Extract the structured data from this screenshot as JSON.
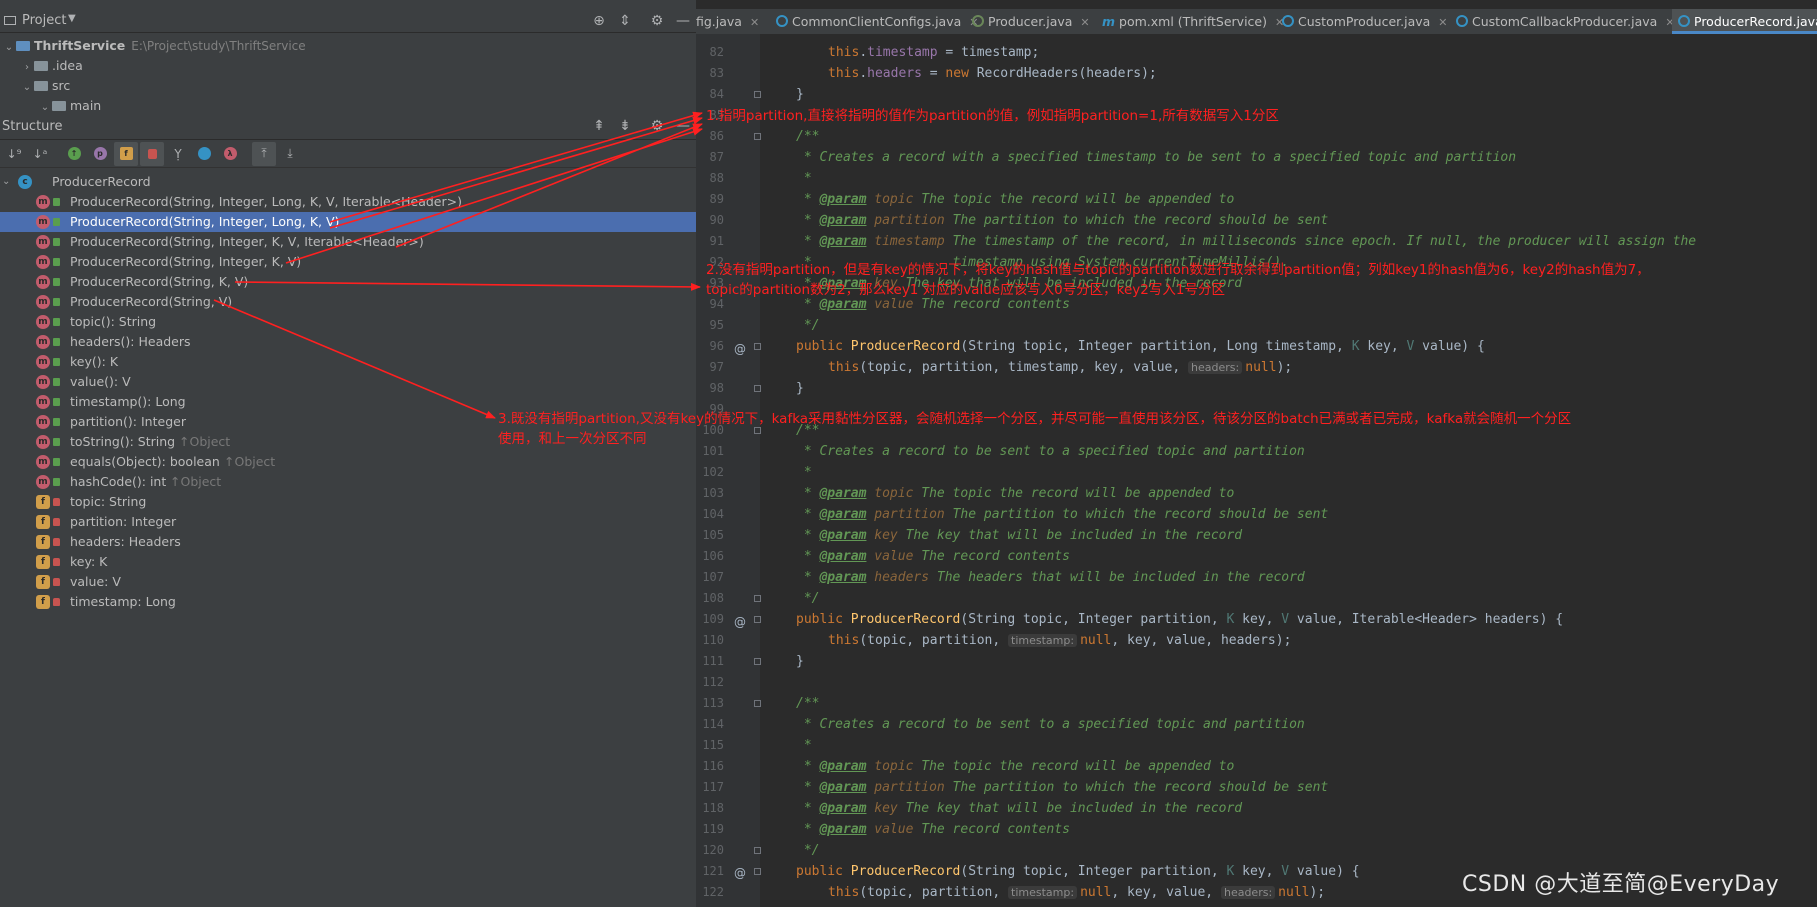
{
  "project_panel": {
    "title": "Project",
    "tree": [
      {
        "label": "ThriftService",
        "path": "E:\\Project\\study\\ThriftService"
      },
      {
        "label": ".idea"
      },
      {
        "label": "src"
      },
      {
        "label": "main"
      }
    ]
  },
  "structure_panel": {
    "title": "Structure",
    "root": "ProducerRecord",
    "items": [
      {
        "kind": "method",
        "label": "ProducerRecord(String, Integer, Long, K, V, Iterable<Header>)"
      },
      {
        "kind": "method",
        "label": "ProducerRecord(String, Integer, Long, K, V)",
        "selected": true
      },
      {
        "kind": "method",
        "label": "ProducerRecord(String, Integer, K, V, Iterable<Header>)"
      },
      {
        "kind": "method",
        "label": "ProducerRecord(String, Integer, K, V)"
      },
      {
        "kind": "method",
        "label": "ProducerRecord(String, K, V)"
      },
      {
        "kind": "method",
        "label": "ProducerRecord(String, V)"
      },
      {
        "kind": "method",
        "label": "topic(): String"
      },
      {
        "kind": "method",
        "label": "headers(): Headers"
      },
      {
        "kind": "method",
        "label": "key(): K"
      },
      {
        "kind": "method",
        "label": "value(): V"
      },
      {
        "kind": "method",
        "label": "timestamp(): Long"
      },
      {
        "kind": "method",
        "label": "partition(): Integer"
      },
      {
        "kind": "method",
        "label": "toString(): String",
        "inherited": "↑Object"
      },
      {
        "kind": "method",
        "label": "equals(Object): boolean",
        "inherited": "↑Object"
      },
      {
        "kind": "method",
        "label": "hashCode(): int",
        "inherited": "↑Object"
      },
      {
        "kind": "field",
        "label": "topic: String"
      },
      {
        "kind": "field",
        "label": "partition: Integer"
      },
      {
        "kind": "field",
        "label": "headers: Headers"
      },
      {
        "kind": "field",
        "label": "key: K"
      },
      {
        "kind": "field",
        "label": "value: V"
      },
      {
        "kind": "field",
        "label": "timestamp: Long"
      }
    ]
  },
  "tabs": [
    {
      "label": "fig.java"
    },
    {
      "label": "CommonClientConfigs.java"
    },
    {
      "label": "Producer.java"
    },
    {
      "label": "pom.xml (ThriftService)"
    },
    {
      "label": "CustomProducer.java"
    },
    {
      "label": "CustomCallbackProducer.java"
    },
    {
      "label": "ProducerRecord.java",
      "active": true
    }
  ],
  "code": {
    "line_numbers": [
      "82",
      "83",
      "84",
      "85",
      "86",
      "87",
      "88",
      "89",
      "90",
      "91",
      "92",
      "93",
      "94",
      "95",
      "96",
      "97",
      "98",
      "99",
      "100",
      "101",
      "102",
      "103",
      "104",
      "105",
      "106",
      "107",
      "108",
      "109",
      "110",
      "111",
      "112",
      "113",
      "114",
      "115",
      "116",
      "117",
      "118",
      "119",
      "120",
      "121",
      "122"
    ],
    "l82_this": "this",
    "l82_field": "timestamp",
    "l82_rest": " = timestamp;",
    "l83_this": "this",
    "l83_field": "headers",
    "l83_eq": " = ",
    "l83_new": "new",
    "l83_rest": " RecordHeaders(headers);",
    "l84": "}",
    "l86": "/**",
    "l87": " * Creates a record with a specified timestamp to be sent to a specified topic and partition",
    "l88": " *",
    "l89_tag": "@param",
    "l89_par": "topic",
    "l89_rest": " The topic the record will be appended to",
    "l90_tag": "@param",
    "l90_par": "partition",
    "l90_rest": " The partition to which the record should be sent",
    "l91_tag": "@param",
    "l91_par": "timestamp",
    "l91_rest": " The timestamp of the record, in milliseconds since epoch. If null, the producer will assign the",
    "l92": " *                  timestamp using System.currentTimeMillis().",
    "l93_tag": "@param",
    "l93_par": "key",
    "l93_rest": " The key that will be included in the record",
    "l94_tag": "@param",
    "l94_par": "value",
    "l94_rest": " The record contents",
    "l95": " */",
    "l96_kw": "public",
    "l96_fn": "ProducerRecord",
    "l96_a": "(String topic, Integer partition, Long timestamp, ",
    "l96_k": "K",
    "l96_b": " key, ",
    "l96_v": "V",
    "l96_c": " value) {",
    "l97_this": "this",
    "l97_a": "(topic, partition, timestamp, key, value, ",
    "l97_hint": "headers:",
    "l97_null": "null",
    "l97_end": ");",
    "l98": "}",
    "l100": "/**",
    "l101": " * Creates a record to be sent to a specified topic and partition",
    "l102": " *",
    "l103_tag": "@param",
    "l103_par": "topic",
    "l103_rest": " The topic the record will be appended to",
    "l104_tag": "@param",
    "l104_par": "partition",
    "l104_rest": " The partition to which the record should be sent",
    "l105_tag": "@param",
    "l105_par": "key",
    "l105_rest": " The key that will be included in the record",
    "l106_tag": "@param",
    "l106_par": "value",
    "l106_rest": " The record contents",
    "l107_tag": "@param",
    "l107_par": "headers",
    "l107_rest": " The headers that will be included in the record",
    "l108": " */",
    "l109_kw": "public",
    "l109_fn": "ProducerRecord",
    "l109_a": "(String topic, Integer partition, ",
    "l109_k": "K",
    "l109_b": " key, ",
    "l109_v": "V",
    "l109_c": " value, Iterable<Header> headers) {",
    "l110_this": "this",
    "l110_a": "(topic, partition, ",
    "l110_hint": "timestamp:",
    "l110_null": "null",
    "l110_end": ", key, value, headers);",
    "l111": "}",
    "l113": "/**",
    "l114": " * Creates a record to be sent to a specified topic and partition",
    "l115": " *",
    "l116_tag": "@param",
    "l116_par": "topic",
    "l116_rest": " The topic the record will be appended to",
    "l117_tag": "@param",
    "l117_par": "partition",
    "l117_rest": " The partition to which the record should be sent",
    "l118_tag": "@param",
    "l118_par": "key",
    "l118_rest": " The key that will be included in the record",
    "l119_tag": "@param",
    "l119_par": "value",
    "l119_rest": " The record contents",
    "l120": " */",
    "l121_kw": "public",
    "l121_fn": "ProducerRecord",
    "l121_a": "(String topic, Integer partition, ",
    "l121_k": "K",
    "l121_b": " key, ",
    "l121_v": "V",
    "l121_c": " value) {",
    "l122_this": "this",
    "l122_a": "(topic, partition, ",
    "l122_hint1": "timestamp:",
    "l122_null1": "null",
    "l122_b": ", key, value, ",
    "l122_hint2": "headers:",
    "l122_null2": "null",
    "l122_end": ");"
  },
  "annotations": {
    "a1": "1.指明partition,直接将指明的值作为partition的值，例如指明partition=1,所有数据写入1分区",
    "a2_line1": "2.没有指明partition，但是有key的情况下，将key的hash值与topic的partition数进行取余得到partition值；列如key1的hash值为6，key2的hash值为7，",
    "a2_line2": "topic的partition数为2，那么key1 对应的value应该写入0号分区，key2写入1号分区",
    "a3_line1": "3.既没有指明partition,又没有key的情况下，kafka采用黏性分区器，会随机选择一个分区，并尽可能一直使用该分区，待该分区的batch已满或者已完成，kafka就会随机一个分区",
    "a3_line2": "使用，和上一次分区不同"
  },
  "watermark": "CSDN @大道至简@EveryDay",
  "colors": {
    "annotation": "#ff2020",
    "selection": "#4b6eaf",
    "keyword": "#cc7832",
    "comment": "#629755",
    "method": "#ffc66d"
  }
}
